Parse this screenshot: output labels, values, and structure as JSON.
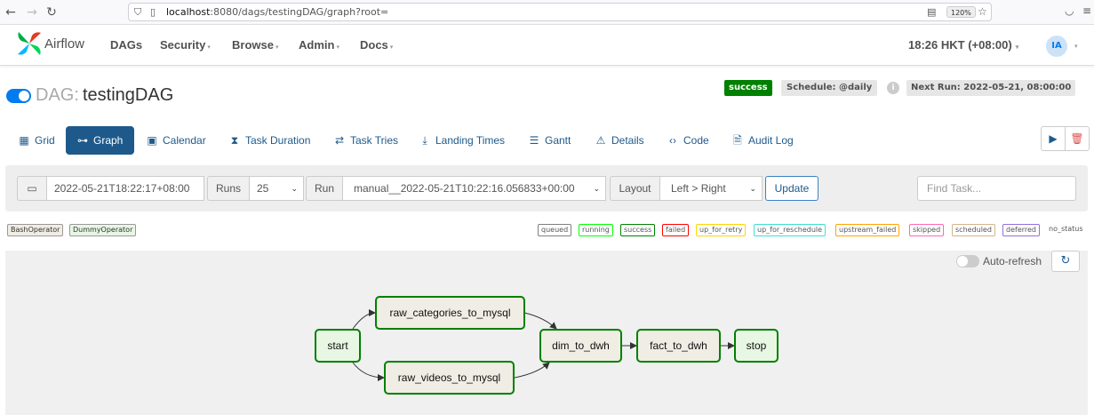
{
  "browser": {
    "url_host": "localhost",
    "url_rest": ":8080/dags/testingDAG/graph?root=",
    "zoom": "120%"
  },
  "nav": {
    "brand": "Airflow",
    "menu": [
      "DAGs",
      "Security",
      "Browse",
      "Admin",
      "Docs"
    ],
    "clock": "18:26 HKT (+08:00)",
    "avatar": "IA"
  },
  "dag": {
    "label": "DAG:",
    "name": "testingDAG",
    "status": "success",
    "schedule": "Schedule: @daily",
    "next_run": "Next Run: 2022-05-21, 08:00:00"
  },
  "tabs": [
    "Grid",
    "Graph",
    "Calendar",
    "Task Duration",
    "Task Tries",
    "Landing Times",
    "Gantt",
    "Details",
    "Code",
    "Audit Log"
  ],
  "controls": {
    "base_date": "2022-05-21T18:22:17+08:00",
    "runs_label": "Runs",
    "runs_value": "25",
    "run_label": "Run",
    "run_value": "manual__2022-05-21T10:22:16.056833+00:00",
    "layout_label": "Layout",
    "layout_value": "Left > Right",
    "update": "Update",
    "find_placeholder": "Find Task..."
  },
  "operators": [
    "BashOperator",
    "DummyOperator"
  ],
  "statuses": [
    {
      "label": "queued",
      "color": "#808080"
    },
    {
      "label": "running",
      "color": "#00ff00"
    },
    {
      "label": "success",
      "color": "#008000"
    },
    {
      "label": "failed",
      "color": "#ff0000"
    },
    {
      "label": "up_for_retry",
      "color": "#ffd700"
    },
    {
      "label": "up_for_reschedule",
      "color": "#40e0d0"
    },
    {
      "label": "upstream_failed",
      "color": "#ffa500"
    },
    {
      "label": "skipped",
      "color": "#ff69b4"
    },
    {
      "label": "scheduled",
      "color": "#d2b48c"
    },
    {
      "label": "deferred",
      "color": "#9370db"
    }
  ],
  "no_status": "no_status",
  "graph": {
    "auto_refresh": "Auto-refresh",
    "tasks": {
      "start": "start",
      "raw_categories": "raw_categories_to_mysql",
      "raw_videos": "raw_videos_to_mysql",
      "dim": "dim_to_dwh",
      "fact": "fact_to_dwh",
      "stop": "stop"
    }
  }
}
